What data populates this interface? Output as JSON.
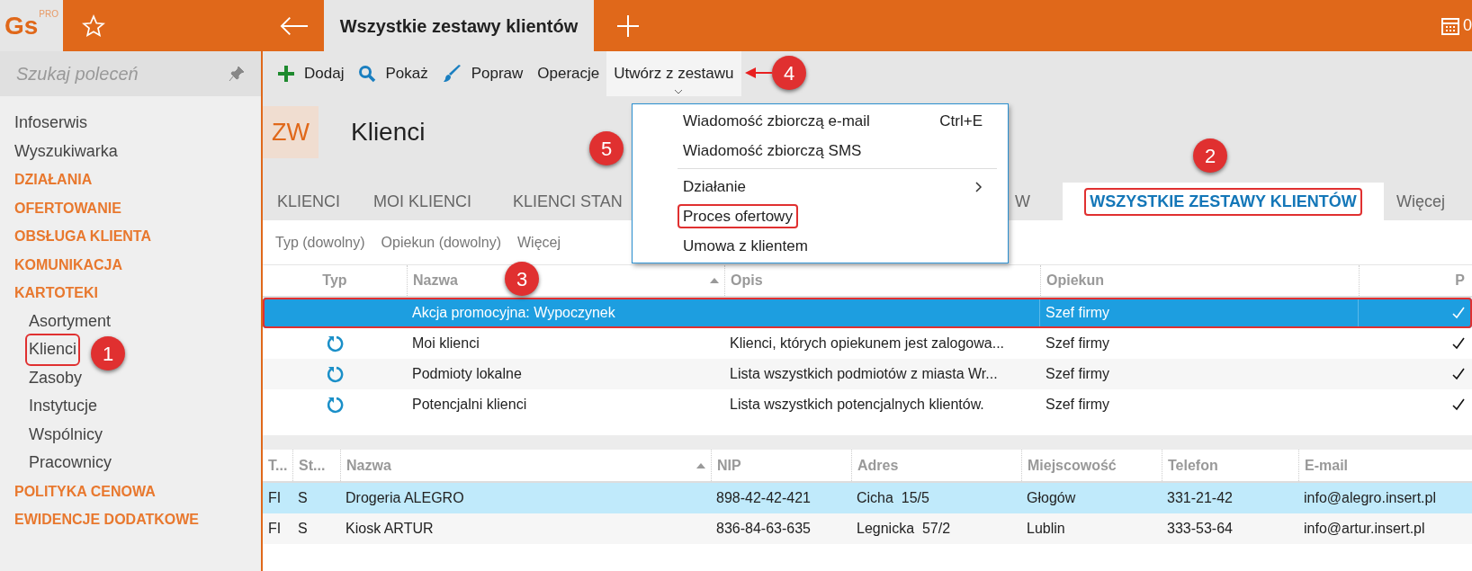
{
  "app": {
    "logo": "Gs",
    "logo_badge": "PRO",
    "active_tab": "Wszystkie zestawy klientów",
    "counter": "0"
  },
  "sidebar": {
    "search": {
      "placeholder": "Szukaj poleceń"
    },
    "items": [
      {
        "label": "Infoserwis",
        "kind": "link",
        "outlined": false
      },
      {
        "label": "Wyszukiwarka",
        "kind": "link",
        "outlined": false
      },
      {
        "label": "DZIAŁANIA",
        "kind": "group",
        "outlined": false
      },
      {
        "label": "OFERTOWANIE",
        "kind": "group",
        "outlined": false
      },
      {
        "label": "OBSŁUGA KLIENTA",
        "kind": "group",
        "outlined": false
      },
      {
        "label": "KOMUNIKACJA",
        "kind": "group",
        "outlined": false
      },
      {
        "label": "KARTOTEKI",
        "kind": "group",
        "outlined": false,
        "children": [
          {
            "label": "Asortyment",
            "kind": "link",
            "outlined": false
          },
          {
            "label": "Klienci",
            "kind": "link",
            "outlined": true
          },
          {
            "label": "Zasoby",
            "kind": "link",
            "outlined": false
          },
          {
            "label": "Instytucje",
            "kind": "link",
            "outlined": false
          },
          {
            "label": "Wspólnicy",
            "kind": "link",
            "outlined": false
          },
          {
            "label": "Pracownicy",
            "kind": "link",
            "outlined": false
          }
        ]
      },
      {
        "label": "POLITYKA CENOWA",
        "kind": "group",
        "outlined": false
      },
      {
        "label": "EWIDENCJE DODATKOWE",
        "kind": "group",
        "outlined": false
      }
    ]
  },
  "toolbar": [
    {
      "label": "Dodaj",
      "kind": "add",
      "selected": false
    },
    {
      "label": "Pokaż",
      "kind": "search",
      "selected": false
    },
    {
      "label": "Popraw",
      "kind": "brush",
      "selected": false
    },
    {
      "label": "Operacje",
      "kind": "plain",
      "selected": false
    },
    {
      "label": "Utwórz z zestawu",
      "kind": "dropdown",
      "selected": true
    }
  ],
  "menu": {
    "items": [
      {
        "kind": "item",
        "label": "Wiadomość zbiorczą e-mail",
        "shortcut": "Ctrl+E",
        "submenu": false,
        "outlined": false
      },
      {
        "kind": "item",
        "label": "Wiadomość zbiorczą SMS",
        "submenu": false,
        "outlined": false
      },
      {
        "kind": "separator"
      },
      {
        "kind": "item",
        "label": "Działanie",
        "submenu": true,
        "outlined": false
      },
      {
        "kind": "item",
        "label": "Proces ofertowy",
        "submenu": false,
        "outlined": true
      },
      {
        "kind": "item",
        "label": "Umowa z klientem",
        "submenu": false,
        "outlined": false
      }
    ]
  },
  "header": {
    "badge": "ZW",
    "title": "Klienci"
  },
  "tabs": [
    {
      "label": "KLIENCI",
      "selected": false,
      "outlined": false
    },
    {
      "label": "MOI KLIENCI",
      "selected": false,
      "outlined": false
    },
    {
      "label": "KLIENCI STAN",
      "selected": false,
      "outlined": false
    },
    {
      "label": "W",
      "selected": false,
      "outlined": false
    },
    {
      "label": "WSZYSTKIE ZESTAWY KLIENTÓW",
      "selected": true,
      "outlined": true
    },
    {
      "label": "Więcej",
      "selected": false,
      "outlined": false
    }
  ],
  "filters": [
    "Typ (dowolny)",
    "Opiekun (dowolny)",
    "Więcej"
  ],
  "sets_table": {
    "columns": [
      "Typ",
      "Nazwa",
      "Opis",
      "Opiekun",
      "P"
    ],
    "rows": [
      {
        "refresh_icon": false,
        "name": "Akcja promocyjna: Wypoczynek",
        "description": "",
        "owner": "Szef firmy",
        "checked": true,
        "selected": true,
        "outlined": true
      },
      {
        "refresh_icon": true,
        "name": "Moi klienci",
        "description": "Klienci, których opiekunem jest zalogowa...",
        "owner": "Szef firmy",
        "checked": true,
        "selected": false,
        "outlined": false
      },
      {
        "refresh_icon": true,
        "name": "Podmioty lokalne",
        "description": "Lista wszystkich podmiotów z miasta Wr...",
        "owner": "Szef firmy",
        "checked": true,
        "selected": false,
        "outlined": false
      },
      {
        "refresh_icon": true,
        "name": "Potencjalni klienci",
        "description": "Lista wszystkich potencjalnych klientów.",
        "owner": "Szef firmy",
        "checked": true,
        "selected": false,
        "outlined": false
      }
    ]
  },
  "clients_table": {
    "columns": [
      "T...",
      "St...",
      "Nazwa",
      "NIP",
      "Adres",
      "Miejscowość",
      "Telefon",
      "E-mail"
    ],
    "rows": [
      {
        "cells": [
          "FI",
          "S",
          "Drogeria ALEGRO",
          "898-42-42-421",
          "Cicha  15/5",
          "Głogów",
          "331-21-42",
          "info@alegro.insert.pl"
        ],
        "selected": true
      },
      {
        "cells": [
          "FI",
          "S",
          "Kiosk ARTUR",
          "836-84-63-635",
          "Legnicka  57/2",
          "Lublin",
          "333-53-64",
          "info@artur.insert.pl"
        ],
        "selected": false
      }
    ]
  },
  "annotations": [
    {
      "label": "1"
    },
    {
      "label": "2"
    },
    {
      "label": "3"
    },
    {
      "label": "4"
    },
    {
      "label": "5"
    }
  ]
}
